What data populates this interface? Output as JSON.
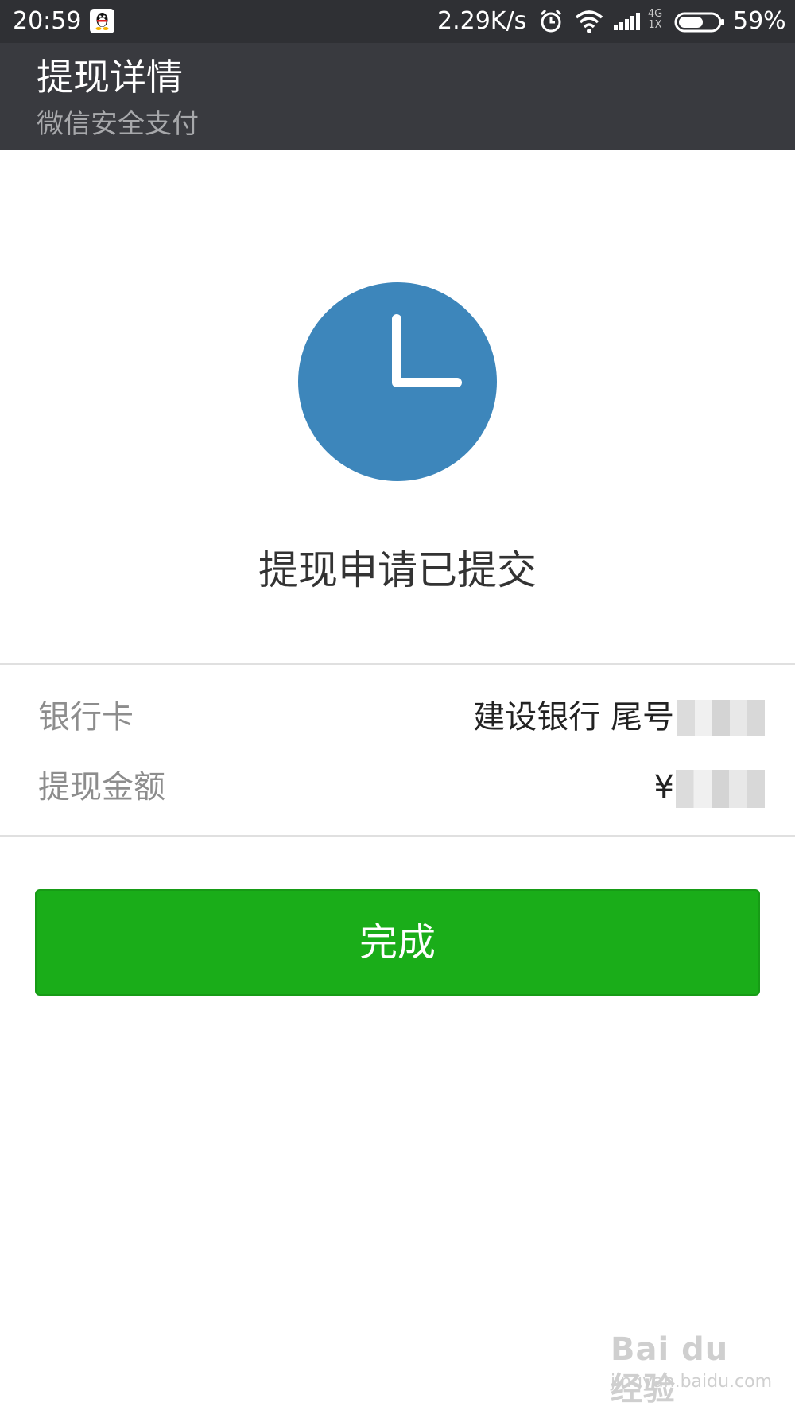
{
  "status_bar": {
    "time": "20:59",
    "network_speed": "2.29K/s",
    "net_type_top": "4G",
    "net_type_bottom": "1X",
    "battery": "59%",
    "icons": [
      "qq-icon",
      "alarm-icon",
      "wifi-icon",
      "signal-icon",
      "battery-icon"
    ]
  },
  "header": {
    "title": "提现详情",
    "subtitle": "微信安全支付"
  },
  "status": {
    "icon": "clock-icon",
    "message": "提现申请已提交",
    "icon_color": "#3d86bb"
  },
  "details": {
    "bank_card_label": "银行卡",
    "bank_card_value": "建设银行 尾号",
    "amount_label": "提现金额",
    "amount_currency": "¥"
  },
  "actions": {
    "done_label": "完成",
    "done_color": "#1aad19"
  },
  "watermark": {
    "main": "Bai du 经验",
    "sub": "jingyan.baidu.com"
  }
}
